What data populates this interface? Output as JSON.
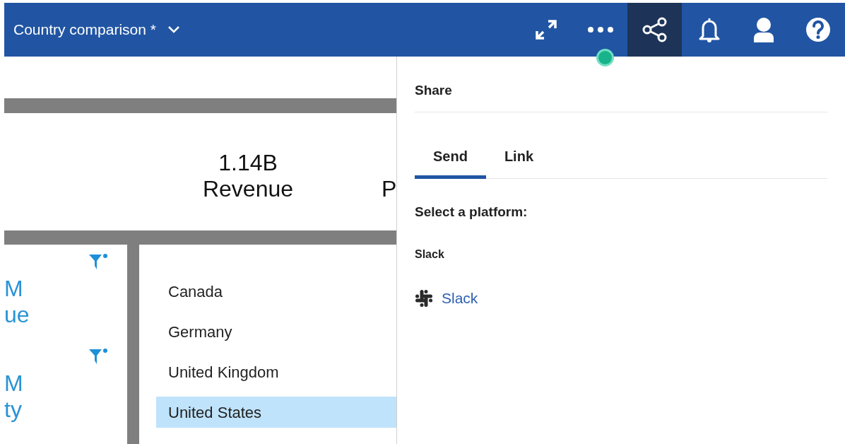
{
  "header": {
    "title": "Country comparison *",
    "actions": [
      {
        "kind": "expand",
        "selected": false
      },
      {
        "kind": "more",
        "selected": false
      },
      {
        "kind": "share",
        "selected": true
      },
      {
        "kind": "bell",
        "selected": false
      },
      {
        "kind": "user",
        "selected": false
      },
      {
        "kind": "help",
        "selected": false
      }
    ]
  },
  "kpi": {
    "value": "1.14B",
    "label": "Revenue",
    "next_label": "P"
  },
  "side_kpis": [
    {
      "line_1": "M",
      "line_2": "ue"
    },
    {
      "line_1": "M",
      "line_2": "ty"
    }
  ],
  "countries": [
    {
      "label": "Canada",
      "selected": false
    },
    {
      "label": "Germany",
      "selected": false
    },
    {
      "label": "United Kingdom",
      "selected": false
    },
    {
      "label": "United States",
      "selected": true
    }
  ],
  "share_panel": {
    "title": "Share",
    "tabs": [
      {
        "label": "Send",
        "selected": true
      },
      {
        "label": "Link",
        "selected": false
      }
    ],
    "prompt": "Select a platform:",
    "section": "Slack",
    "platforms": [
      {
        "label": "Slack"
      }
    ]
  }
}
